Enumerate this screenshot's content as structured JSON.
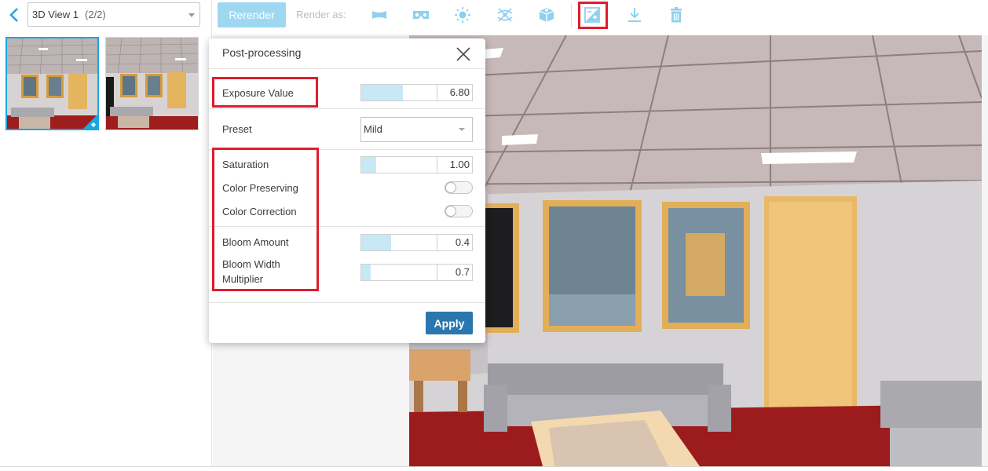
{
  "left_panel": {
    "view_select": {
      "value": "3D View 1",
      "counter": "(2/2)"
    }
  },
  "toolbar": {
    "rerender_label": "Rerender",
    "render_as_label": "Render as:",
    "icons": [
      "panorama-icon",
      "stereo-vr-icon",
      "illuminance-icon",
      "sun-path-icon",
      "cube-render-icon",
      "adjust-exposure-icon",
      "download-icon",
      "delete-icon"
    ]
  },
  "dialog": {
    "title": "Post-processing",
    "exposure": {
      "label": "Exposure Value",
      "value": "6.80",
      "fill_fraction": 0.55
    },
    "preset": {
      "label": "Preset",
      "value": "Mild"
    },
    "saturation": {
      "label": "Saturation",
      "value": "1.00",
      "fill_fraction": 0.2
    },
    "color_preserving": {
      "label": "Color Preserving",
      "on": false
    },
    "color_correction": {
      "label": "Color Correction",
      "on": false
    },
    "bloom_amount": {
      "label": "Bloom Amount",
      "value": "0.4",
      "fill_fraction": 0.4
    },
    "bloom_width": {
      "label": "Bloom Width Multiplier",
      "value": "0.7",
      "fill_fraction": 0.13
    },
    "apply_label": "Apply"
  },
  "colors": {
    "accent": "#1aa7e1",
    "highlight": "#e11d2d",
    "apply_button": "#2b77ad",
    "slider_fill": "#c9e8f6"
  }
}
